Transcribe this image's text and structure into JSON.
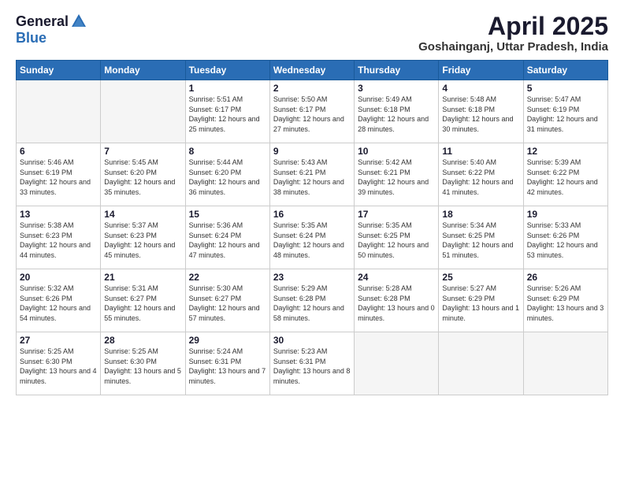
{
  "header": {
    "logo_general": "General",
    "logo_blue": "Blue",
    "month_year": "April 2025",
    "location": "Goshainganj, Uttar Pradesh, India"
  },
  "days_of_week": [
    "Sunday",
    "Monday",
    "Tuesday",
    "Wednesday",
    "Thursday",
    "Friday",
    "Saturday"
  ],
  "weeks": [
    [
      {
        "day": "",
        "sunrise": "",
        "sunset": "",
        "daylight": "",
        "empty": true
      },
      {
        "day": "",
        "sunrise": "",
        "sunset": "",
        "daylight": "",
        "empty": true
      },
      {
        "day": "1",
        "sunrise": "Sunrise: 5:51 AM",
        "sunset": "Sunset: 6:17 PM",
        "daylight": "Daylight: 12 hours and 25 minutes."
      },
      {
        "day": "2",
        "sunrise": "Sunrise: 5:50 AM",
        "sunset": "Sunset: 6:17 PM",
        "daylight": "Daylight: 12 hours and 27 minutes."
      },
      {
        "day": "3",
        "sunrise": "Sunrise: 5:49 AM",
        "sunset": "Sunset: 6:18 PM",
        "daylight": "Daylight: 12 hours and 28 minutes."
      },
      {
        "day": "4",
        "sunrise": "Sunrise: 5:48 AM",
        "sunset": "Sunset: 6:18 PM",
        "daylight": "Daylight: 12 hours and 30 minutes."
      },
      {
        "day": "5",
        "sunrise": "Sunrise: 5:47 AM",
        "sunset": "Sunset: 6:19 PM",
        "daylight": "Daylight: 12 hours and 31 minutes."
      }
    ],
    [
      {
        "day": "6",
        "sunrise": "Sunrise: 5:46 AM",
        "sunset": "Sunset: 6:19 PM",
        "daylight": "Daylight: 12 hours and 33 minutes."
      },
      {
        "day": "7",
        "sunrise": "Sunrise: 5:45 AM",
        "sunset": "Sunset: 6:20 PM",
        "daylight": "Daylight: 12 hours and 35 minutes."
      },
      {
        "day": "8",
        "sunrise": "Sunrise: 5:44 AM",
        "sunset": "Sunset: 6:20 PM",
        "daylight": "Daylight: 12 hours and 36 minutes."
      },
      {
        "day": "9",
        "sunrise": "Sunrise: 5:43 AM",
        "sunset": "Sunset: 6:21 PM",
        "daylight": "Daylight: 12 hours and 38 minutes."
      },
      {
        "day": "10",
        "sunrise": "Sunrise: 5:42 AM",
        "sunset": "Sunset: 6:21 PM",
        "daylight": "Daylight: 12 hours and 39 minutes."
      },
      {
        "day": "11",
        "sunrise": "Sunrise: 5:40 AM",
        "sunset": "Sunset: 6:22 PM",
        "daylight": "Daylight: 12 hours and 41 minutes."
      },
      {
        "day": "12",
        "sunrise": "Sunrise: 5:39 AM",
        "sunset": "Sunset: 6:22 PM",
        "daylight": "Daylight: 12 hours and 42 minutes."
      }
    ],
    [
      {
        "day": "13",
        "sunrise": "Sunrise: 5:38 AM",
        "sunset": "Sunset: 6:23 PM",
        "daylight": "Daylight: 12 hours and 44 minutes."
      },
      {
        "day": "14",
        "sunrise": "Sunrise: 5:37 AM",
        "sunset": "Sunset: 6:23 PM",
        "daylight": "Daylight: 12 hours and 45 minutes."
      },
      {
        "day": "15",
        "sunrise": "Sunrise: 5:36 AM",
        "sunset": "Sunset: 6:24 PM",
        "daylight": "Daylight: 12 hours and 47 minutes."
      },
      {
        "day": "16",
        "sunrise": "Sunrise: 5:35 AM",
        "sunset": "Sunset: 6:24 PM",
        "daylight": "Daylight: 12 hours and 48 minutes."
      },
      {
        "day": "17",
        "sunrise": "Sunrise: 5:35 AM",
        "sunset": "Sunset: 6:25 PM",
        "daylight": "Daylight: 12 hours and 50 minutes."
      },
      {
        "day": "18",
        "sunrise": "Sunrise: 5:34 AM",
        "sunset": "Sunset: 6:25 PM",
        "daylight": "Daylight: 12 hours and 51 minutes."
      },
      {
        "day": "19",
        "sunrise": "Sunrise: 5:33 AM",
        "sunset": "Sunset: 6:26 PM",
        "daylight": "Daylight: 12 hours and 53 minutes."
      }
    ],
    [
      {
        "day": "20",
        "sunrise": "Sunrise: 5:32 AM",
        "sunset": "Sunset: 6:26 PM",
        "daylight": "Daylight: 12 hours and 54 minutes."
      },
      {
        "day": "21",
        "sunrise": "Sunrise: 5:31 AM",
        "sunset": "Sunset: 6:27 PM",
        "daylight": "Daylight: 12 hours and 55 minutes."
      },
      {
        "day": "22",
        "sunrise": "Sunrise: 5:30 AM",
        "sunset": "Sunset: 6:27 PM",
        "daylight": "Daylight: 12 hours and 57 minutes."
      },
      {
        "day": "23",
        "sunrise": "Sunrise: 5:29 AM",
        "sunset": "Sunset: 6:28 PM",
        "daylight": "Daylight: 12 hours and 58 minutes."
      },
      {
        "day": "24",
        "sunrise": "Sunrise: 5:28 AM",
        "sunset": "Sunset: 6:28 PM",
        "daylight": "Daylight: 13 hours and 0 minutes."
      },
      {
        "day": "25",
        "sunrise": "Sunrise: 5:27 AM",
        "sunset": "Sunset: 6:29 PM",
        "daylight": "Daylight: 13 hours and 1 minute."
      },
      {
        "day": "26",
        "sunrise": "Sunrise: 5:26 AM",
        "sunset": "Sunset: 6:29 PM",
        "daylight": "Daylight: 13 hours and 3 minutes."
      }
    ],
    [
      {
        "day": "27",
        "sunrise": "Sunrise: 5:25 AM",
        "sunset": "Sunset: 6:30 PM",
        "daylight": "Daylight: 13 hours and 4 minutes."
      },
      {
        "day": "28",
        "sunrise": "Sunrise: 5:25 AM",
        "sunset": "Sunset: 6:30 PM",
        "daylight": "Daylight: 13 hours and 5 minutes."
      },
      {
        "day": "29",
        "sunrise": "Sunrise: 5:24 AM",
        "sunset": "Sunset: 6:31 PM",
        "daylight": "Daylight: 13 hours and 7 minutes."
      },
      {
        "day": "30",
        "sunrise": "Sunrise: 5:23 AM",
        "sunset": "Sunset: 6:31 PM",
        "daylight": "Daylight: 13 hours and 8 minutes."
      },
      {
        "day": "",
        "sunrise": "",
        "sunset": "",
        "daylight": "",
        "empty": true
      },
      {
        "day": "",
        "sunrise": "",
        "sunset": "",
        "daylight": "",
        "empty": true
      },
      {
        "day": "",
        "sunrise": "",
        "sunset": "",
        "daylight": "",
        "empty": true
      }
    ]
  ]
}
